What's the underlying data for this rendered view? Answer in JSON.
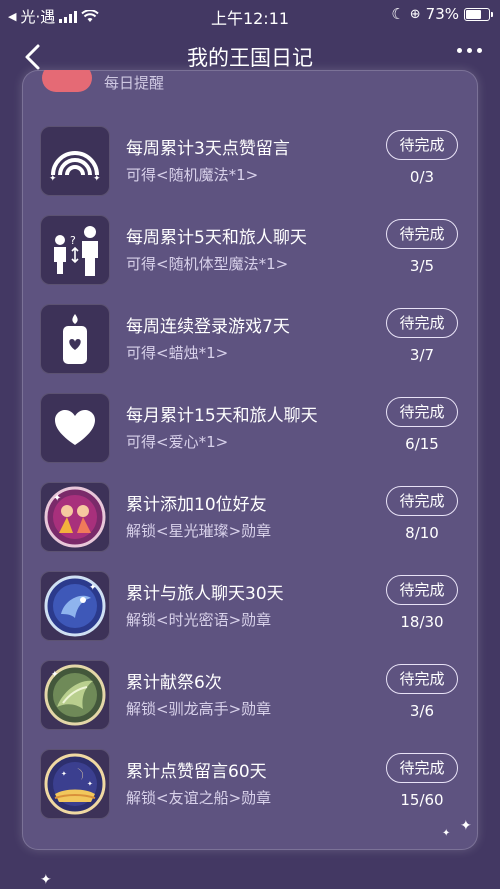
{
  "status_bar": {
    "carrier": "光·遇",
    "time": "上午12:11",
    "battery_percent": "73%",
    "battery_level": 0.73
  },
  "nav": {
    "title": "我的王国日记"
  },
  "peek_label": "每日提醒",
  "tasks": [
    {
      "icon": "rainbow-icon",
      "name": "每周累计3天点赞留言",
      "reward": "可得<随机魔法*1>",
      "button": "待完成",
      "progress": "0/3"
    },
    {
      "icon": "body-type-icon",
      "name": "每周累计5天和旅人聊天",
      "reward": "可得<随机体型魔法*1>",
      "button": "待完成",
      "progress": "3/5"
    },
    {
      "icon": "candle-icon",
      "name": "每周连续登录游戏7天",
      "reward": "可得<蜡烛*1>",
      "button": "待完成",
      "progress": "3/7"
    },
    {
      "icon": "heart-icon",
      "name": "每月累计15天和旅人聊天",
      "reward": "可得<爱心*1>",
      "button": "待完成",
      "progress": "6/15"
    },
    {
      "icon": "starlight-badge-icon",
      "name": "累计添加10位好友",
      "reward": "解锁<星光璀璨>勋章",
      "button": "待完成",
      "progress": "8/10"
    },
    {
      "icon": "time-whisper-badge-icon",
      "name": "累计与旅人聊天30天",
      "reward": "解锁<时光密语>勋章",
      "button": "待完成",
      "progress": "18/30"
    },
    {
      "icon": "dragon-master-badge-icon",
      "name": "累计献祭6次",
      "reward": "解锁<驯龙高手>勋章",
      "button": "待完成",
      "progress": "3/6"
    },
    {
      "icon": "friendship-ship-badge-icon",
      "name": "累计点赞留言60天",
      "reward": "解锁<友谊之船>勋章",
      "button": "待完成",
      "progress": "15/60"
    }
  ]
}
